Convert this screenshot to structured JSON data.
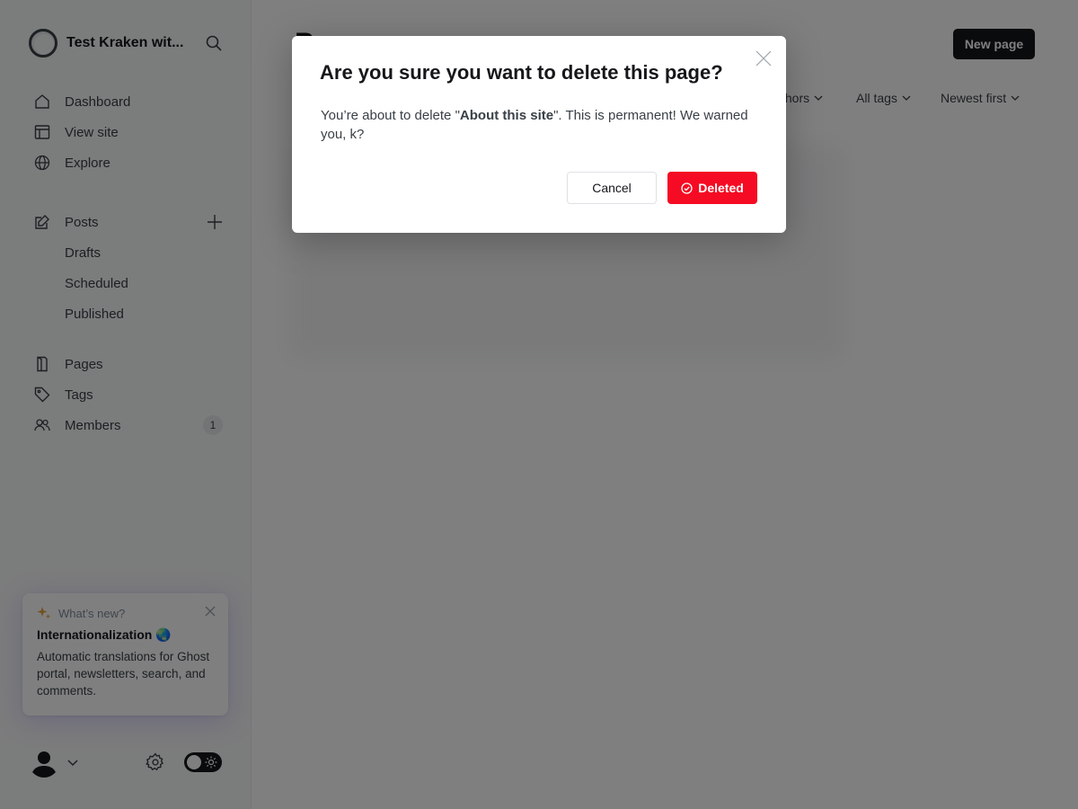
{
  "sidebar": {
    "site_title": "Test Kraken wit...",
    "nav": [
      {
        "label": "Dashboard"
      },
      {
        "label": "View site"
      },
      {
        "label": "Explore"
      }
    ],
    "posts": {
      "label": "Posts",
      "sub": [
        {
          "label": "Drafts"
        },
        {
          "label": "Scheduled"
        },
        {
          "label": "Published"
        }
      ]
    },
    "nav2": [
      {
        "label": "Pages"
      },
      {
        "label": "Tags"
      },
      {
        "label": "Members",
        "count": "1"
      }
    ],
    "whats_new": {
      "heading": "What’s new?",
      "title": "Internationalization 🌏",
      "body": "Automatic translations for Ghost portal, newsletters, search, and comments."
    }
  },
  "main": {
    "page_title": "P",
    "new_button": "New page",
    "filters": {
      "authors": "thors",
      "tags": "All tags",
      "sort": "Newest first"
    }
  },
  "modal": {
    "title": "Are you sure you want to delete this page?",
    "text_before": "You’re about to delete \"",
    "item_name": "About this site",
    "text_after": "\". This is permanent! We warned you, k?",
    "cancel_label": "Cancel",
    "delete_label": "Deleted"
  },
  "colors": {
    "danger": "#f50b23",
    "dark": "#15171a",
    "sidebar_bg": "#f7f8f9"
  }
}
